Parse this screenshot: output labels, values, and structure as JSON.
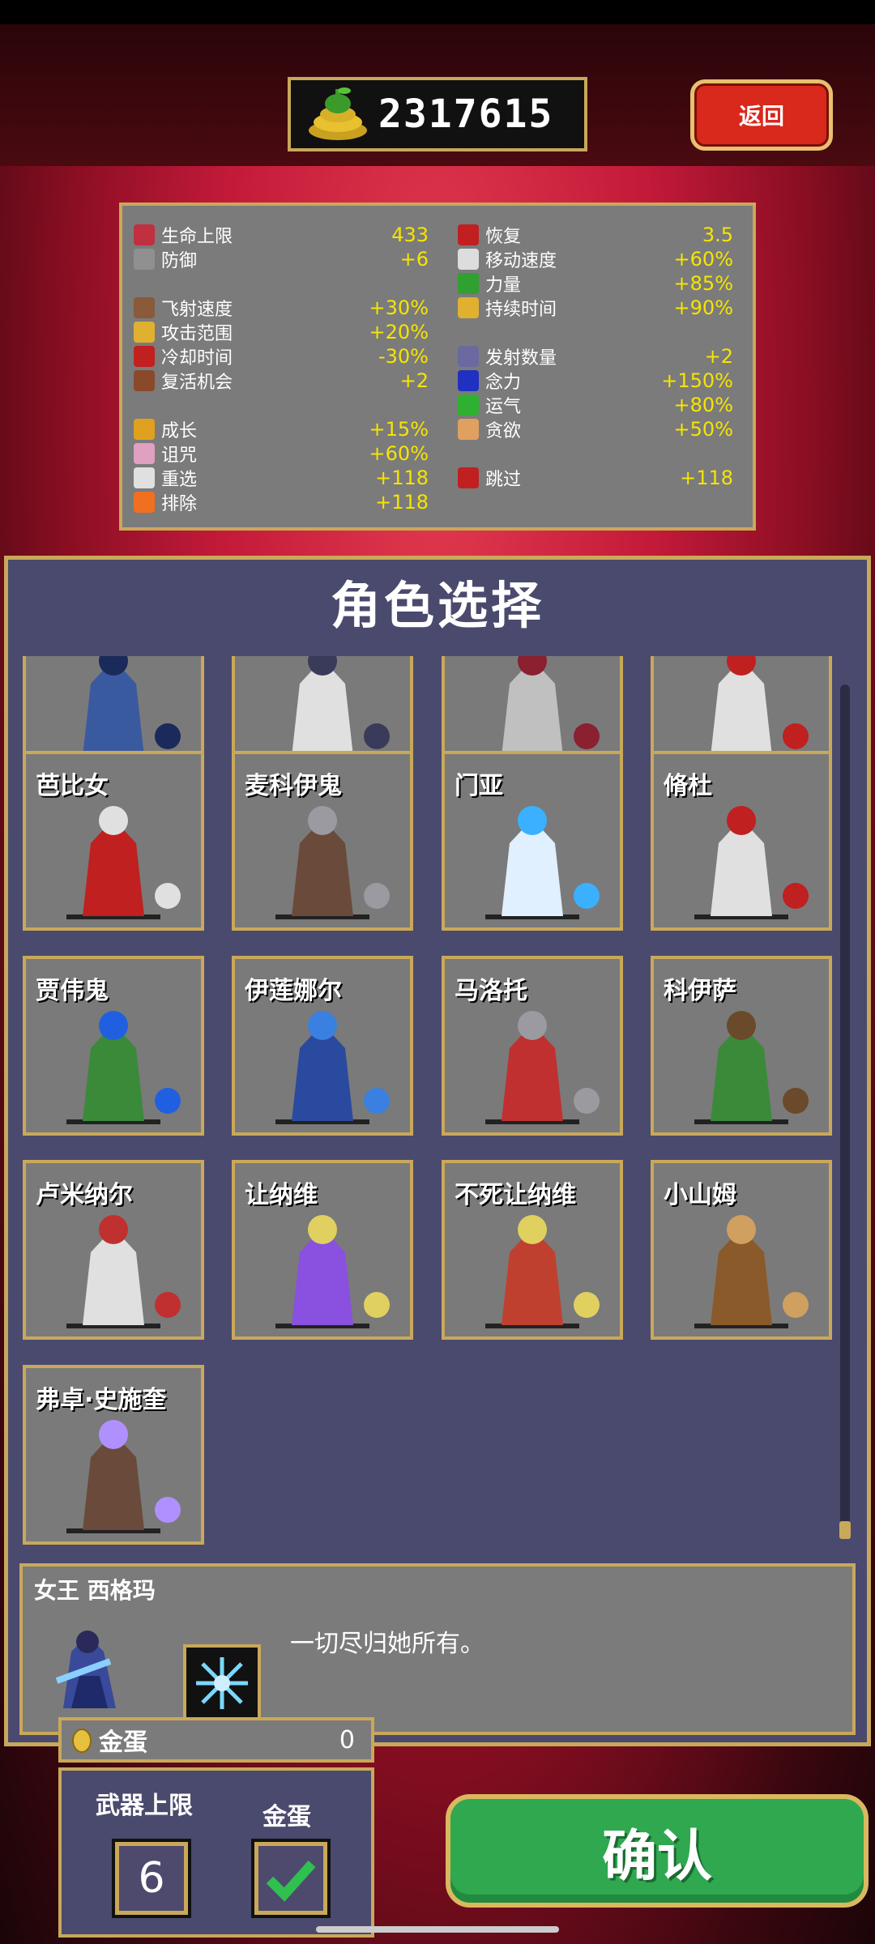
{
  "currency": {
    "amount": "2317615",
    "icon": "gold-coin-pile-icon"
  },
  "back_label": "返回",
  "stats": {
    "left": [
      {
        "label": "生命上限",
        "value": "433",
        "icon": "heart-icon"
      },
      {
        "label": "防御",
        "value": "+6",
        "icon": "armor-icon"
      },
      {
        "label": "飞射速度",
        "value": "+30%",
        "icon": "speed-icon"
      },
      {
        "label": "攻击范围",
        "value": "+20%",
        "icon": "area-icon"
      },
      {
        "label": "冷却时间",
        "value": "-30%",
        "icon": "cooldown-icon"
      },
      {
        "label": "复活机会",
        "value": "+2",
        "icon": "revival-icon"
      },
      {
        "label": "成长",
        "value": "+15%",
        "icon": "crown-icon"
      },
      {
        "label": "诅咒",
        "value": "+60%",
        "icon": "skull-icon"
      },
      {
        "label": "重选",
        "value": "+118",
        "icon": "dice-icon"
      },
      {
        "label": "排除",
        "value": "+118",
        "icon": "banish-icon"
      }
    ],
    "right": [
      {
        "label": "恢复",
        "value": "3.5",
        "icon": "regen-heart-icon"
      },
      {
        "label": "移动速度",
        "value": "+60%",
        "icon": "wing-icon"
      },
      {
        "label": "力量",
        "value": "+85%",
        "icon": "leaf-icon"
      },
      {
        "label": "持续时间",
        "value": "+90%",
        "icon": "hourglass-icon"
      },
      {
        "label": "发射数量",
        "value": "+2",
        "icon": "amount-icon"
      },
      {
        "label": "念力",
        "value": "+150%",
        "icon": "orb-icon"
      },
      {
        "label": "运气",
        "value": "+80%",
        "icon": "clover-icon"
      },
      {
        "label": "贪欲",
        "value": "+50%",
        "icon": "greed-icon"
      },
      {
        "label": "跳过",
        "value": "+118",
        "icon": "skip-icon"
      }
    ]
  },
  "panel_title": "角色选择",
  "characters": [
    {
      "name": ""
    },
    {
      "name": ""
    },
    {
      "name": ""
    },
    {
      "name": ""
    },
    {
      "name": "芭比女"
    },
    {
      "name": "麦科伊鬼"
    },
    {
      "name": "门亚"
    },
    {
      "name": "脩杜"
    },
    {
      "name": "贾伟鬼"
    },
    {
      "name": "伊莲娜尔"
    },
    {
      "name": "马洛托"
    },
    {
      "name": "科伊萨"
    },
    {
      "name": "卢米纳尔"
    },
    {
      "name": "让纳维"
    },
    {
      "name": "不死让纳维"
    },
    {
      "name": "小山姆"
    },
    {
      "name": "弗卓·史施奎"
    }
  ],
  "selected": {
    "name": "女王  西格玛",
    "description": "一切尽归她所有。"
  },
  "golden_egg": {
    "label": "金蛋",
    "count": "0"
  },
  "options": {
    "weapon_limit_label": "武器上限",
    "weapon_limit_value": "6",
    "golden_egg_label": "金蛋"
  },
  "confirm_label": "确认"
}
